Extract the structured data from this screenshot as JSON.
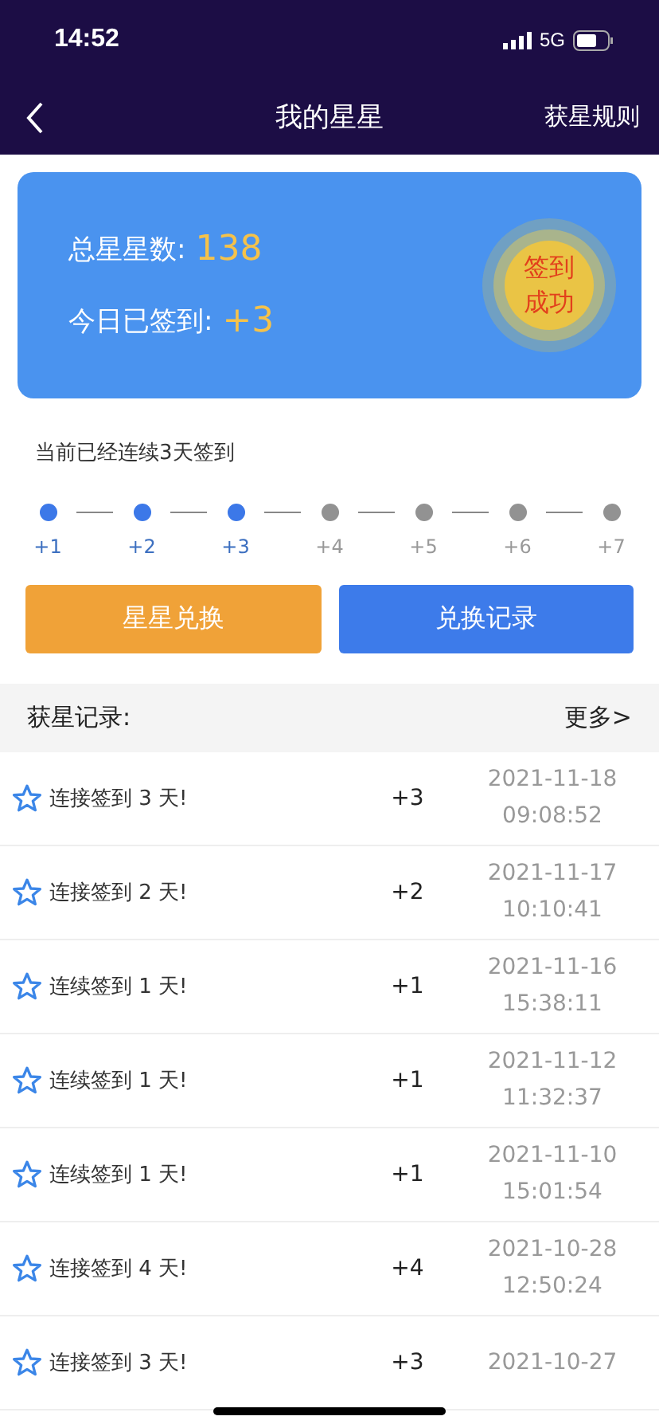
{
  "status_bar": {
    "time": "14:52",
    "network": "5G"
  },
  "nav": {
    "title": "我的星星",
    "action": "获星规则"
  },
  "summary": {
    "total_label": "总星星数:",
    "total_value": "138",
    "today_label": "今日已签到:",
    "today_value": "+3",
    "badge": [
      "签到",
      "成功"
    ]
  },
  "streak": {
    "text": "当前已经连续3天签到",
    "steps": [
      {
        "label": "+1",
        "done": true
      },
      {
        "label": "+2",
        "done": true
      },
      {
        "label": "+3",
        "done": true
      },
      {
        "label": "+4",
        "done": false
      },
      {
        "label": "+5",
        "done": false
      },
      {
        "label": "+6",
        "done": false
      },
      {
        "label": "+7",
        "done": false
      }
    ]
  },
  "buttons": [
    {
      "label": "星星兑换",
      "kind": "orange"
    },
    {
      "label": "兑换记录",
      "kind": "blue"
    }
  ],
  "records": {
    "title": "获星记录:",
    "more": "更多>",
    "rows": [
      {
        "text": "连接签到 3 天!",
        "points": "+3",
        "date": "2021-11-18",
        "time": "09:08:52"
      },
      {
        "text": "连接签到 2 天!",
        "points": "+2",
        "date": "2021-11-17",
        "time": "10:10:41"
      },
      {
        "text": "连续签到 1 天!",
        "points": "+1",
        "date": "2021-11-16",
        "time": "15:38:11"
      },
      {
        "text": "连续签到 1 天!",
        "points": "+1",
        "date": "2021-11-12",
        "time": "11:32:37"
      },
      {
        "text": "连续签到 1 天!",
        "points": "+1",
        "date": "2021-11-10",
        "time": "15:01:54"
      },
      {
        "text": "连接签到 4 天!",
        "points": "+4",
        "date": "2021-10-28",
        "time": "12:50:24"
      },
      {
        "text": "连接签到 3 天!",
        "points": "+3",
        "date": "2021-10-27"
      }
    ]
  }
}
